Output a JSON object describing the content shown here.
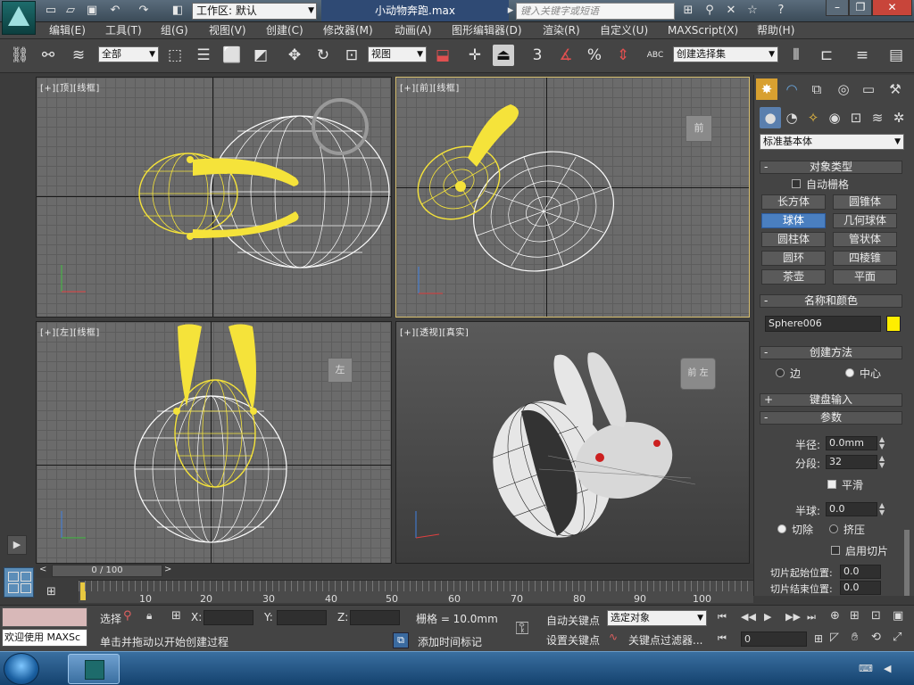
{
  "window": {
    "workspace_label": "工作区: 默认",
    "document_title": "小动物奔跑.max",
    "search_placeholder": "键入关键字或短语"
  },
  "menu": [
    "编辑(E)",
    "工具(T)",
    "组(G)",
    "视图(V)",
    "创建(C)",
    "修改器(M)",
    "动画(A)",
    "图形编辑器(D)",
    "渲染(R)",
    "自定义(U)",
    "MAXScript(X)",
    "帮助(H)"
  ],
  "toolbar": {
    "selection_filter": "全部",
    "reference_coord": "视图",
    "named_selection": "创建选择集",
    "snap_3": "3",
    "percent": "%",
    "abc": "ABC"
  },
  "viewports": {
    "top": {
      "bracket": "[+]",
      "name": "[顶]",
      "mode": "[线框]"
    },
    "front": {
      "bracket": "[+]",
      "name": "[前]",
      "mode": "[线框]"
    },
    "left": {
      "bracket": "[+]",
      "name": "[左]",
      "mode": "[线框]"
    },
    "perspective": {
      "bracket": "[+]",
      "name": "[透视]",
      "mode": "[真实]"
    },
    "viewcube_front": "前",
    "viewcube_left": "左",
    "viewcube_persp": "前 左"
  },
  "command_panel": {
    "category": "标准基本体",
    "object_type": {
      "title": "对象类型",
      "auto_grid": "自动栅格",
      "buttons": [
        "长方体",
        "圆锥体",
        "球体",
        "几何球体",
        "圆柱体",
        "管状体",
        "圆环",
        "四棱锥",
        "茶壶",
        "平面"
      ],
      "active": "球体"
    },
    "name_color": {
      "title": "名称和颜色",
      "object_name": "Sphere006",
      "color": "#ffee00"
    },
    "creation_method": {
      "title": "创建方法",
      "edge": "边",
      "center": "中心",
      "selected": "中心"
    },
    "keyboard_entry": {
      "title": "键盘输入"
    },
    "parameters": {
      "title": "参数",
      "radius_label": "半径:",
      "radius": "0.0mm",
      "segments_label": "分段:",
      "segments": "32",
      "smooth": "平滑",
      "smooth_checked": true,
      "hemisphere_label": "半球:",
      "hemisphere": "0.0",
      "chop": "切除",
      "squash": "挤压",
      "selected": "切除",
      "slice_on": "启用切片",
      "slice_from_label": "切片起始位置:",
      "slice_from": "0.0",
      "slice_to_label": "切片结束位置:",
      "slice_to": "0.0"
    }
  },
  "timeline": {
    "frame": "0 / 100",
    "ticks": [
      "10",
      "20",
      "30",
      "40",
      "50",
      "60",
      "70",
      "80",
      "90",
      "100"
    ]
  },
  "status": {
    "welcome": "欢迎使用 MAXSc",
    "select_label": "选择",
    "x_label": "X:",
    "y_label": "Y:",
    "z_label": "Z:",
    "grid": "栅格 = 10.0mm",
    "prompt": "单击并拖动以开始创建过程",
    "add_time_tag": "添加时间标记",
    "auto_key": "自动关键点",
    "set_key": "设置关键点",
    "selected_object": "选定对象",
    "key_filters": "关键点过滤器...",
    "current_frame": "0"
  },
  "colors": {
    "selection_yellow": "#f5e33a",
    "active_blue": "#4a7fc0"
  }
}
